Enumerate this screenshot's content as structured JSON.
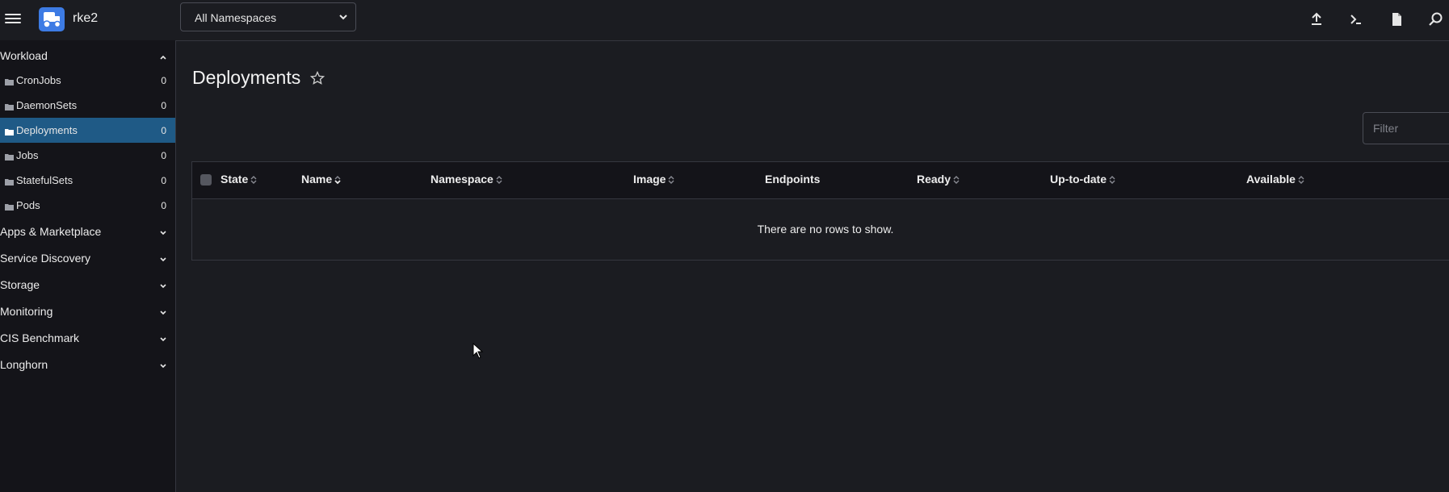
{
  "header": {
    "cluster_name": "rke2",
    "namespace_select": "All Namespaces",
    "icons": [
      "menu-icon",
      "cluster-logo-icon",
      "chevron-down-icon",
      "upload-icon",
      "terminal-icon",
      "file-icon",
      "search-icon"
    ]
  },
  "sidebar": {
    "workload": {
      "label": "Workload",
      "items": [
        {
          "label": "CronJobs",
          "count": "0"
        },
        {
          "label": "DaemonSets",
          "count": "0"
        },
        {
          "label": "Deployments",
          "count": "0"
        },
        {
          "label": "Jobs",
          "count": "0"
        },
        {
          "label": "StatefulSets",
          "count": "0"
        },
        {
          "label": "Pods",
          "count": "0"
        }
      ]
    },
    "groups": [
      {
        "label": "Apps & Marketplace"
      },
      {
        "label": "Service Discovery"
      },
      {
        "label": "Storage"
      },
      {
        "label": "Monitoring"
      },
      {
        "label": "CIS Benchmark"
      },
      {
        "label": "Longhorn"
      }
    ]
  },
  "main": {
    "title": "Deployments",
    "filter_placeholder": "Filter",
    "columns": [
      "State",
      "Name",
      "Namespace",
      "Image",
      "Endpoints",
      "Ready",
      "Up-to-date",
      "Available"
    ],
    "empty_message": "There are no rows to show."
  },
  "colors": {
    "background": "#1b1c21",
    "sidebar": "#141419",
    "active_item": "#1f5a86",
    "logo": "#3d7be4"
  }
}
